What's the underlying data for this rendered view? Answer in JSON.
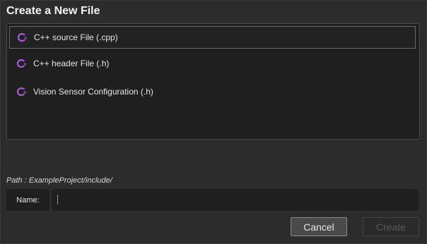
{
  "dialog": {
    "title": "Create a New File"
  },
  "file_types": [
    {
      "label": "C++ source File (.cpp)",
      "icon": "cpp-icon",
      "selected": true
    },
    {
      "label": "C++ header File (.h)",
      "icon": "cpp-icon",
      "selected": false
    },
    {
      "label": "Vision Sensor Configuration (.h)",
      "icon": "cpp-icon",
      "selected": false
    }
  ],
  "path_text": "Path : ExampleProject/include/",
  "name_field": {
    "label": "Name:",
    "value": ""
  },
  "buttons": {
    "cancel": "Cancel",
    "create": "Create"
  },
  "colors": {
    "icon_purple": "#a35bd6",
    "background": "#2c2c2c",
    "panel": "#1f1f1f"
  }
}
